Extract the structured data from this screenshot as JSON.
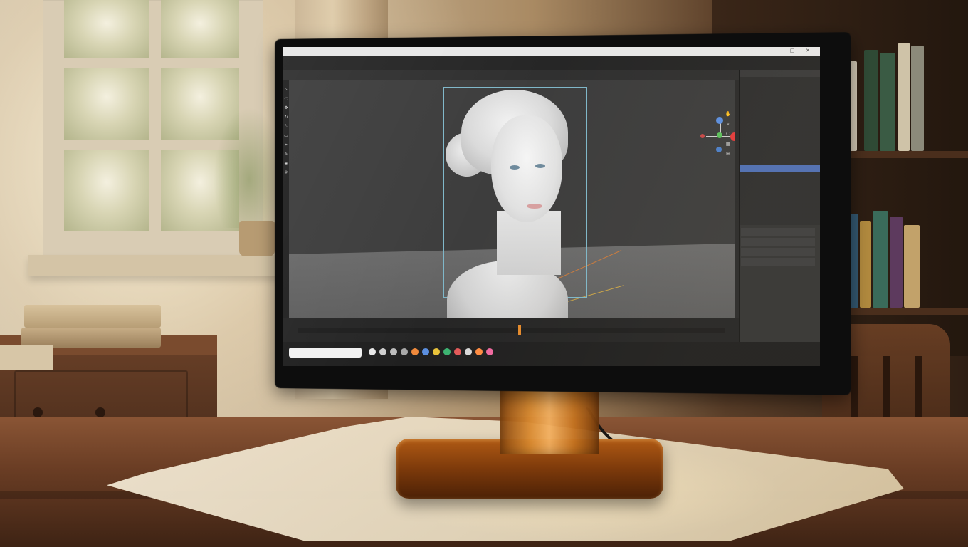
{
  "scene": {
    "description_tags": [
      "window",
      "curtain",
      "desk",
      "paper",
      "monitor",
      "bookshelf",
      "chair",
      "books"
    ],
    "colors": {
      "wood": "#6a3d24",
      "amber_stand": "#d98a30",
      "screen_bg": "#2b2b2b",
      "selection_blue": "#4f6fb3",
      "camera_frame": "#7fb7c9"
    }
  },
  "app": {
    "titlebar": {
      "text": "",
      "controls": [
        "–",
        "□",
        "✕"
      ]
    },
    "menu": [
      "",
      "",
      "",
      "",
      "",
      "",
      "",
      "",
      "",
      "",
      "",
      "",
      "",
      "",
      "",
      ""
    ],
    "toolbar2": [
      "",
      "",
      "",
      "",
      "",
      "",
      "",
      ""
    ],
    "left_tools": [
      "▹",
      "◌",
      "✥",
      "↻",
      "⤡",
      "▭",
      "⌖",
      "✎",
      "◈",
      "⚲"
    ],
    "viewport_tools": [
      "✋",
      "⌕",
      "⎔",
      "▦",
      "⊞"
    ],
    "outliner": {
      "title": "",
      "rows": [
        "",
        "",
        "",
        "",
        "",
        "",
        "",
        "",
        "",
        "",
        "",
        "",
        "",
        "",
        "",
        ""
      ],
      "selected_index": 11
    },
    "properties": [
      "",
      "",
      "",
      ""
    ],
    "timeline_menu": [
      "",
      "",
      "",
      "",
      ""
    ],
    "taskbar": {
      "search_placeholder": "",
      "tray_time": ""
    }
  }
}
